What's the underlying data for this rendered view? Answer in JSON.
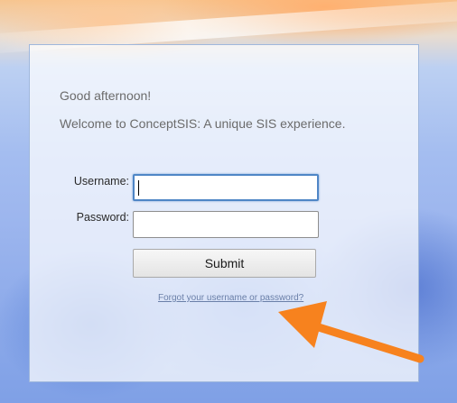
{
  "login": {
    "greeting": "Good afternoon!",
    "welcome": "Welcome to ConceptSIS: A unique SIS experience.",
    "username_label": "Username:",
    "password_label": "Password:",
    "username_value": "",
    "password_value": "",
    "submit_label": "Submit",
    "forgot_link": "Forgot your username or password?"
  },
  "colors": {
    "arrow": "#f7821e",
    "focus_border": "#4f86c6",
    "link": "#6a7fa8"
  }
}
